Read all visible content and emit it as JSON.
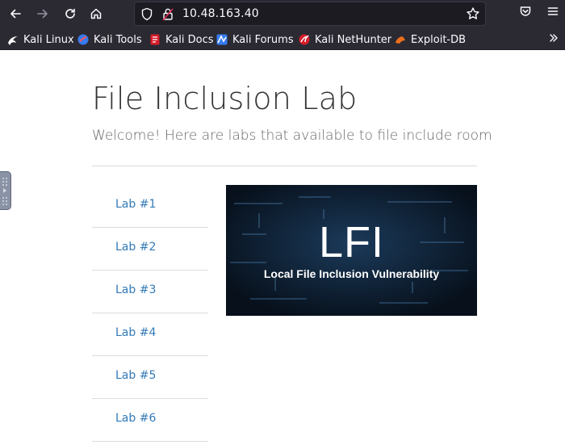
{
  "browser": {
    "url": "10.48.163.40",
    "bookmarks": [
      {
        "label": "Kali Linux",
        "icon": "kali-dragon-icon"
      },
      {
        "label": "Kali Tools",
        "icon": "kali-tools-icon"
      },
      {
        "label": "Kali Docs",
        "icon": "kali-docs-icon"
      },
      {
        "label": "Kali Forums",
        "icon": "kali-forums-icon"
      },
      {
        "label": "Kali NetHunter",
        "icon": "nethunter-icon"
      },
      {
        "label": "Exploit-DB",
        "icon": "exploit-db-icon"
      }
    ]
  },
  "page": {
    "title": "File Inclusion Lab",
    "lead": "Welcome! Here are labs that available to file include room",
    "labs": [
      "Lab #1",
      "Lab #2",
      "Lab #3",
      "Lab #4",
      "Lab #5",
      "Lab #6"
    ],
    "banner": {
      "title": "LFI",
      "subtitle": "Local File Inclusion Vulnerability"
    }
  },
  "colors": {
    "chrome": "#2b2a33",
    "urlbar": "#1c1b22",
    "link": "#337ab7",
    "banner_bg": "#0b1522"
  }
}
